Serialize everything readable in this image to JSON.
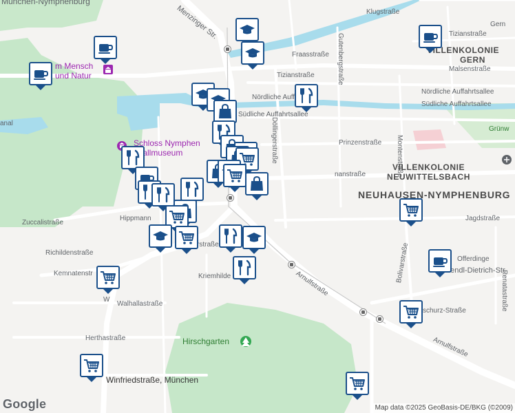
{
  "colors": {
    "marker_border": "#1a4f8a",
    "marker_icon": "#1a4f8a",
    "park": "#c6e7c9",
    "water": "#a8dcec",
    "road": "#ffffff"
  },
  "street_labels": {
    "muenchen_nymphenburg": "München-Nymphenburg",
    "menzinger_str": "Menzinger Str.",
    "klugstrasse": "Klugstraße",
    "tizianstrasse_ne": "Tizianstraße",
    "gern": "Gern",
    "fraasstrasse": "Fraasstraße",
    "gutenbergstrasse": "Gutenbergstraße",
    "tizianstrasse": "Tizianstraße",
    "malsenstrasse": "Malsenstraße",
    "noerdliche_auffahrtsallee": "Nördliche Auffahrtsallee",
    "noerdliche_auffahrtsallee_short": "Nördliche Auff",
    "suedliche_auffahrtsallee": "Südliche Auffahrtsallee",
    "suedliche_auffahrtsallee_short": "Südliche Auffahrtsallee",
    "gruenw": "Grünw",
    "doellingerstrasse": "Döllingerstraße",
    "montenstrasse": "Montenstraße",
    "prinzenstrasse": "Prinzenstraße",
    "nstrasse": "nanstraße",
    "zuccalistrasse": "Zuccalistraße",
    "hippmann": "Hippmann",
    "richildenstrasse": "Richildenstraße",
    "kemnatenstr": "Kemnatenstr",
    "kriemhilden": "Kriemhilde",
    "rstrasse": "rstraße",
    "arnulfstrasse": "Arnulfstraße",
    "arnulfstrasse_2": "Arnulfstraße",
    "jagdstrasse": "Jagdstraße",
    "bolivarstrasse": "Bolivarstraße",
    "offerdinger": "Offerdinge",
    "wendl_dietrich": "Wendl-Dietrich-Str",
    "renatastrasse": "Renatastraße",
    "schurz": "schurz-Straße",
    "walhallastrasse": "Walhallastraße",
    "wa": "W",
    "herthastrasse": "Herthastraße",
    "winfriedstrasse": "Winfriedstraße, München",
    "kanal": "anal"
  },
  "districts": {
    "villenkolonie_gern_1": "VILLENKOLONIE",
    "villenkolonie_gern_2": "GERN",
    "villenkolonie_neuwittelsbach_1": "VILLENKOLONIE",
    "villenkolonie_neuwittelsbach_2": "NEUWITTELSBACH",
    "neuhausen_nymphenburg": "NEUHAUSEN-NYMPHENBURG"
  },
  "pois": {
    "museum_mensch_1": "m Mensch",
    "museum_mensch_2": "und Natur",
    "schloss_1": "Schloss Nymphen",
    "schloss_2": "rstallmuseum",
    "hirschgarten": "Hirschgarten"
  },
  "markers": [
    {
      "icon": "graduation-cap",
      "name": "school"
    },
    {
      "icon": "coffee-cup",
      "name": "cafe"
    },
    {
      "icon": "coffee-cup",
      "name": "cafe"
    },
    {
      "icon": "coffee-cup",
      "name": "cafe"
    },
    {
      "icon": "graduation-cap",
      "name": "school"
    },
    {
      "icon": "graduation-cap",
      "name": "school"
    },
    {
      "icon": "fork-knife",
      "name": "restaurant"
    },
    {
      "icon": "graduation-cap",
      "name": "school"
    },
    {
      "icon": "shopping-bag",
      "name": "shop"
    },
    {
      "icon": "fork-knife",
      "name": "restaurant"
    },
    {
      "icon": "shopping-bag",
      "name": "shop"
    },
    {
      "icon": "graduation-cap",
      "name": "school"
    },
    {
      "icon": "fork-knife",
      "name": "restaurant"
    },
    {
      "icon": "shopping-bag",
      "name": "shop"
    },
    {
      "icon": "shopping-cart",
      "name": "supermarket"
    },
    {
      "icon": "shopping-bag",
      "name": "shop"
    },
    {
      "icon": "shopping-bag",
      "name": "shop"
    },
    {
      "icon": "coffee-cup",
      "name": "cafe"
    },
    {
      "icon": "fork-knife",
      "name": "restaurant"
    },
    {
      "icon": "fork-knife",
      "name": "restaurant"
    },
    {
      "icon": "fork-knife",
      "name": "restaurant"
    },
    {
      "icon": "shopping-bag",
      "name": "shop"
    },
    {
      "icon": "shopping-cart",
      "name": "supermarket"
    },
    {
      "icon": "graduation-cap",
      "name": "school"
    },
    {
      "icon": "shopping-cart",
      "name": "supermarket"
    },
    {
      "icon": "fork-knife",
      "name": "restaurant"
    },
    {
      "icon": "graduation-cap",
      "name": "school"
    },
    {
      "icon": "graduation-cap",
      "name": "school"
    },
    {
      "icon": "fork-knife",
      "name": "restaurant"
    },
    {
      "icon": "shopping-cart",
      "name": "supermarket"
    },
    {
      "icon": "shopping-cart",
      "name": "supermarket"
    },
    {
      "icon": "shopping-cart",
      "name": "supermarket"
    },
    {
      "icon": "coffee-cup",
      "name": "cafe"
    },
    {
      "icon": "shopping-cart",
      "name": "supermarket"
    },
    {
      "icon": "shopping-cart",
      "name": "supermarket"
    },
    {
      "icon": "shopping-cart",
      "name": "supermarket"
    }
  ],
  "google_logo": "Google",
  "attribution": "Map data ©2025 GeoBasis-DE/BKG (©2009)"
}
